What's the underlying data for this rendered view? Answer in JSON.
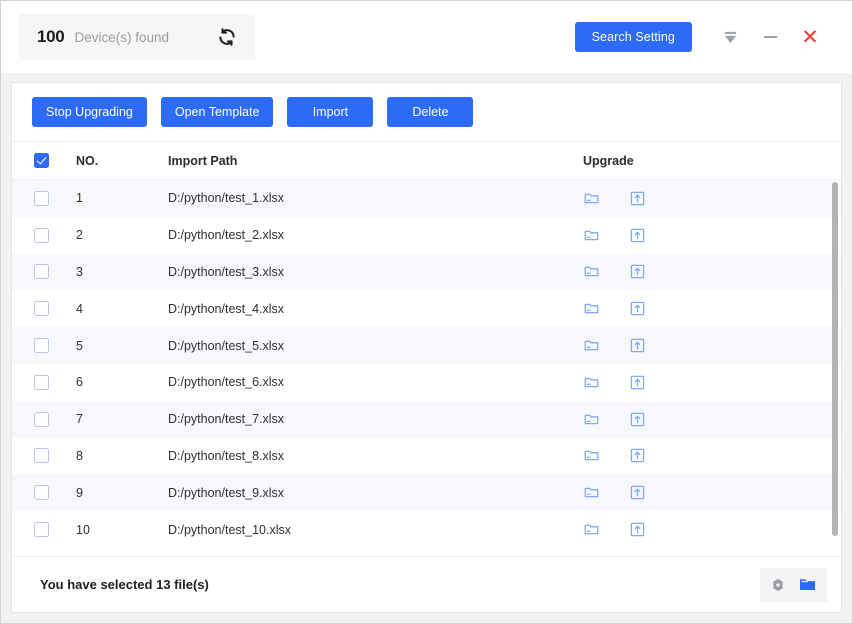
{
  "titlebar": {
    "device_count": "100",
    "device_label": "Device(s) found",
    "refresh_icon": "refresh-icon",
    "search_setting_label": "Search Setting",
    "filter_icon": "filter-icon",
    "minimize_icon": "minimize-icon",
    "close_icon": "close-icon"
  },
  "toolbar": {
    "buttons": [
      {
        "label": "Stop Upgrading"
      },
      {
        "label": "Open Template"
      },
      {
        "label": "Import"
      },
      {
        "label": "Delete"
      }
    ]
  },
  "table": {
    "select_all_checked": true,
    "headers": {
      "no": "NO.",
      "import_path": "Import Path",
      "upgrade": "Upgrade"
    },
    "rows": [
      {
        "no": "1",
        "path": "D:/python/test_1.xlsx",
        "checked": false
      },
      {
        "no": "2",
        "path": "D:/python/test_2.xlsx",
        "checked": false
      },
      {
        "no": "3",
        "path": "D:/python/test_3.xlsx",
        "checked": false
      },
      {
        "no": "4",
        "path": "D:/python/test_4.xlsx",
        "checked": false
      },
      {
        "no": "5",
        "path": "D:/python/test_5.xlsx",
        "checked": false
      },
      {
        "no": "6",
        "path": "D:/python/test_6.xlsx",
        "checked": false
      },
      {
        "no": "7",
        "path": "D:/python/test_7.xlsx",
        "checked": false
      },
      {
        "no": "8",
        "path": "D:/python/test_8.xlsx",
        "checked": false
      },
      {
        "no": "9",
        "path": "D:/python/test_9.xlsx",
        "checked": false
      },
      {
        "no": "10",
        "path": "D:/python/test_10.xlsx",
        "checked": false
      }
    ],
    "row_icons": {
      "file_icon": "file-icon",
      "upload_icon": "upload-icon"
    }
  },
  "footer": {
    "status_text": "You have selected 13 file(s)",
    "settings_icon": "settings-hexagon-icon",
    "folder_icon": "folder-icon"
  },
  "colors": {
    "accent_blue": "#2d6bf7",
    "close_red": "#ee3b32",
    "row_stripe": "#f6f8fb",
    "icon_blue": "#7fa8f5",
    "muted_gray": "#9b9b9b"
  }
}
